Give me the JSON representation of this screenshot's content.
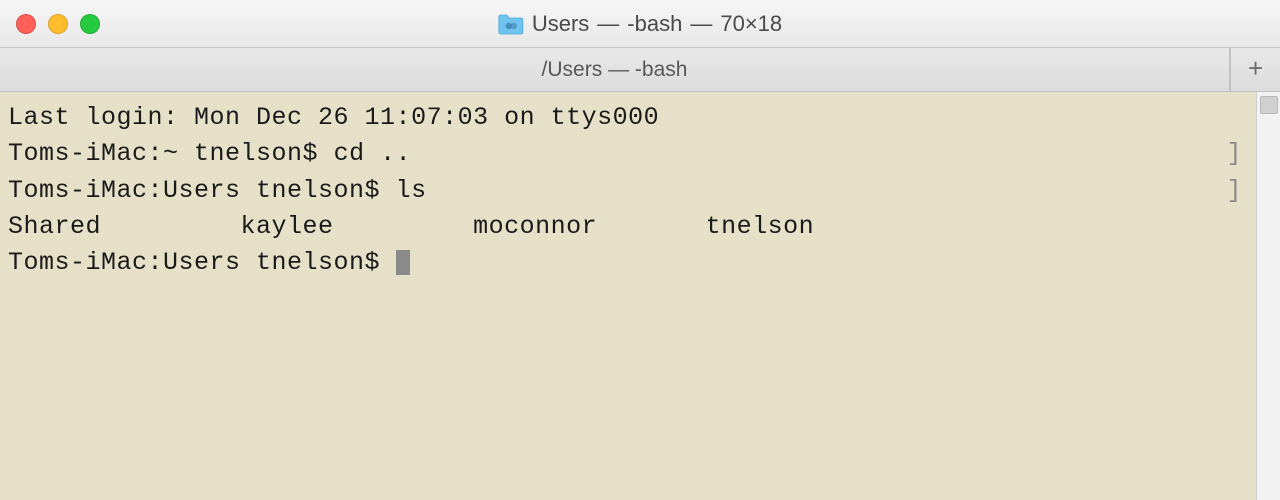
{
  "window": {
    "title_folder": "Users",
    "title_shell": "-bash",
    "title_size": "70×18"
  },
  "tab": {
    "path": "/Users",
    "shell": "-bash"
  },
  "terminal": {
    "last_login": "Last login: Mon Dec 26 11:07:03 on ttys000",
    "line2_prompt": "Toms-iMac:~ tnelson$ ",
    "line2_cmd": "cd ..",
    "line3_prompt": "Toms-iMac:Users tnelson$ ",
    "line3_cmd": "ls",
    "ls_output": "Shared         kaylee         moconnor       tnelson",
    "line5_prompt": "Toms-iMac:Users tnelson$ "
  }
}
